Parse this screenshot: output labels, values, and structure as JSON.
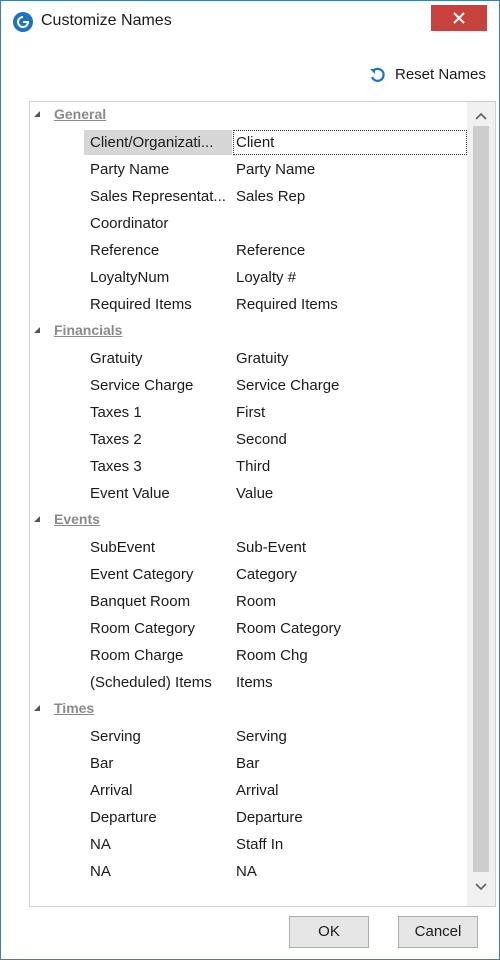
{
  "window": {
    "title": "Customize Names",
    "close_glyph": "×"
  },
  "toolbar": {
    "reset_label": "Reset Names",
    "reset_icon": "refresh-icon"
  },
  "groups": [
    {
      "name": "General",
      "items": [
        {
          "key": "Client/Organizati...",
          "value": "Client",
          "selected": true
        },
        {
          "key": "Party Name",
          "value": "Party Name"
        },
        {
          "key": "Sales Representat...",
          "value": "Sales Rep"
        },
        {
          "key": "Coordinator",
          "value": ""
        },
        {
          "key": "Reference",
          "value": "Reference"
        },
        {
          "key": "LoyaltyNum",
          "value": "Loyalty #"
        },
        {
          "key": "Required Items",
          "value": "Required Items"
        }
      ]
    },
    {
      "name": "Financials",
      "items": [
        {
          "key": "Gratuity",
          "value": "Gratuity"
        },
        {
          "key": "Service Charge",
          "value": "Service Charge"
        },
        {
          "key": "Taxes 1",
          "value": "First"
        },
        {
          "key": "Taxes 2",
          "value": "Second"
        },
        {
          "key": "Taxes 3",
          "value": "Third"
        },
        {
          "key": "Event Value",
          "value": "Value"
        }
      ]
    },
    {
      "name": "Events",
      "items": [
        {
          "key": "SubEvent",
          "value": "Sub-Event"
        },
        {
          "key": "Event Category",
          "value": "Category"
        },
        {
          "key": "Banquet Room",
          "value": "Room"
        },
        {
          "key": "Room Category",
          "value": "Room Category"
        },
        {
          "key": "Room Charge",
          "value": "Room Chg"
        },
        {
          "key": "(Scheduled) Items",
          "value": "Items"
        }
      ]
    },
    {
      "name": "Times",
      "items": [
        {
          "key": "Serving",
          "value": "Serving"
        },
        {
          "key": "Bar",
          "value": "Bar"
        },
        {
          "key": "Arrival",
          "value": "Arrival"
        },
        {
          "key": "Departure",
          "value": "Departure"
        },
        {
          "key": "NA",
          "value": "Staff In"
        },
        {
          "key": "NA",
          "value": "NA"
        }
      ]
    }
  ],
  "buttons": {
    "ok": "OK",
    "cancel": "Cancel"
  },
  "colors": {
    "accent": "#1e73be",
    "close": "#c7423c",
    "selection": "#d6d6d6"
  }
}
